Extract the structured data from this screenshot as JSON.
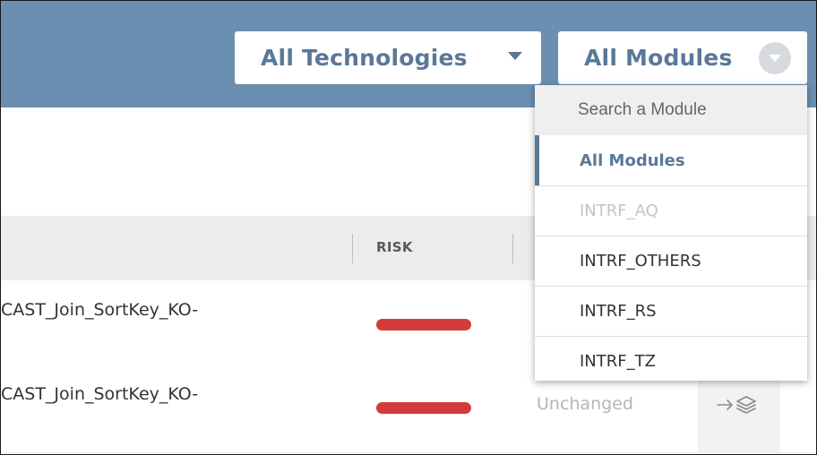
{
  "header": {
    "technology_select": {
      "label": "All Technologies"
    },
    "module_select": {
      "label": "All Modules"
    }
  },
  "table": {
    "columns": {
      "risk": "RISK"
    },
    "rows": [
      {
        "name": "CAST_Join_SortKey_KO-",
        "status": ""
      },
      {
        "name": "CAST_Join_SortKey_KO-",
        "status": "Unchanged"
      }
    ]
  },
  "module_dropdown": {
    "search_placeholder": "Search a Module",
    "items": [
      {
        "label": "All Modules",
        "state": "selected"
      },
      {
        "label": "INTRF_AQ",
        "state": "disabled"
      },
      {
        "label": "INTRF_OTHERS",
        "state": "normal"
      },
      {
        "label": "INTRF_RS",
        "state": "normal"
      },
      {
        "label": "INTRF_TZ",
        "state": "normal"
      }
    ]
  },
  "colors": {
    "header_bg": "#6a8fb0",
    "accent": "#5a7898",
    "risk_bar": "#d43c3c"
  },
  "icons": {
    "row_action": "arrow-layers-icon"
  }
}
